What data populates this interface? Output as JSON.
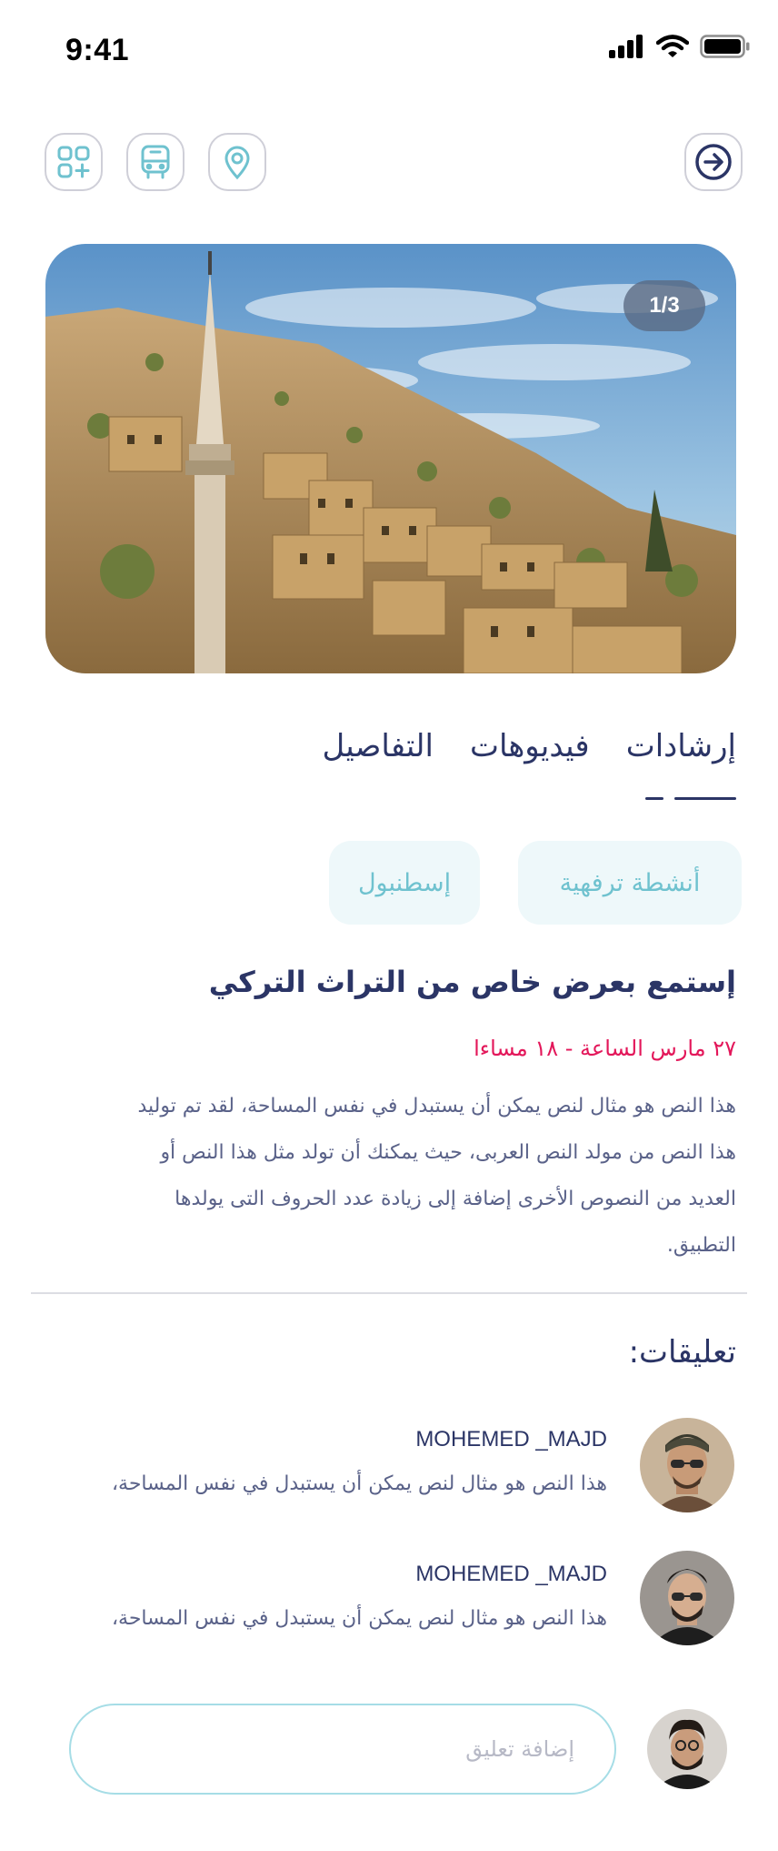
{
  "status_bar": {
    "time": "9:41"
  },
  "top_actions": {
    "left_icons": [
      "apps-add-icon",
      "bus-icon",
      "location-pin-icon"
    ],
    "right_icon": "arrow-right-circle-icon"
  },
  "hero": {
    "counter": "1/3"
  },
  "tabs": [
    {
      "label": "التفاصيل",
      "active": true
    },
    {
      "label": "فيديوهات",
      "active": false
    },
    {
      "label": "إرشادات",
      "active": false
    }
  ],
  "tags": [
    "أنشطة ترفهية",
    "إسطنبول"
  ],
  "event": {
    "title": "إستمع بعرض خاص من التراث التركي",
    "time": "٢٧ مارس الساعة - ١٨ مساءا",
    "description": "هذا النص هو مثال لنص يمكن أن يستبدل في نفس المساحة، لقد تم توليد هذا النص من مولد النص العربى، حيث يمكنك أن تولد مثل هذا النص أو العديد من النصوص الأخرى إضافة إلى زيادة عدد الحروف التى يولدها التطبيق."
  },
  "comments": {
    "heading": "تعليقات:",
    "items": [
      {
        "user": "MOHEMED _MAJD",
        "text": "هذا النص هو مثال لنص يمكن أن يستبدل في نفس المساحة،"
      },
      {
        "user": "MOHEMED _MAJD",
        "text": "هذا النص هو مثال لنص يمكن أن يستبدل في نفس المساحة،"
      }
    ],
    "input_placeholder": "إضافة تعليق"
  },
  "colors": {
    "primary_text": "#2b3566",
    "accent_teal": "#6fc2cf",
    "accent_red": "#e3175a",
    "tag_bg": "#eef8fa"
  }
}
